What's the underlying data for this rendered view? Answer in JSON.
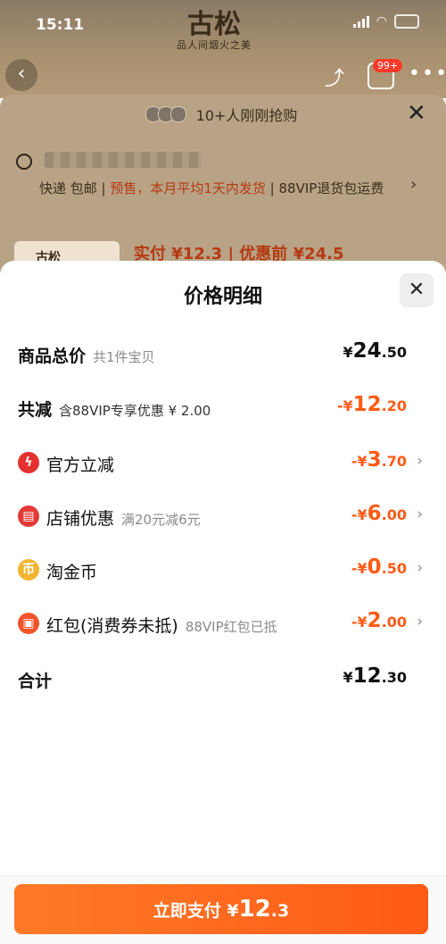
{
  "status_bar": {
    "time": "15:11"
  },
  "brand": {
    "logo_text": "古松",
    "tagline": "品人间烟火之美"
  },
  "header": {
    "cart_badge": "99+"
  },
  "background_sheet": {
    "social_proof": "10+人刚刚抢购",
    "shipping_prefix": "快递 包邮 | ",
    "shipping_warn": "预售，本月平均1天内发货",
    "shipping_suffix": " | 88VIP退货包运费",
    "product_brand": "古松",
    "price_preview": "实付 ¥12.3 | 优惠前 ¥24.5"
  },
  "modal": {
    "title": "价格明细",
    "rows": [
      {
        "label": "商品总价",
        "sub": "共1件宝贝",
        "amount_sym": "¥",
        "amount_int": "24",
        "amount_dec": ".50"
      },
      {
        "label": "共减",
        "sub": "含88VIP专享优惠 ¥ 2.00",
        "amount_sym": "-¥",
        "amount_int": "12",
        "amount_dec": ".20"
      },
      {
        "label": "官方立减",
        "sub": "",
        "amount_sym": "-¥",
        "amount_int": "3",
        "amount_dec": ".70"
      },
      {
        "label": "店铺优惠",
        "sub": "满20元减6元",
        "amount_sym": "-¥",
        "amount_int": "6",
        "amount_dec": ".00"
      },
      {
        "label": "淘金币",
        "sub": "",
        "amount_sym": "-¥",
        "amount_int": "0",
        "amount_dec": ".50"
      },
      {
        "label": "红包(消费券未抵)",
        "sub": "88VIP红包已抵",
        "amount_sym": "-¥",
        "amount_int": "2",
        "amount_dec": ".00"
      },
      {
        "label": "合计",
        "sub": "",
        "amount_sym": "¥",
        "amount_int": "12",
        "amount_dec": ".30"
      }
    ],
    "icons": [
      "lightning-icon",
      "shop-icon",
      "gold-coin-icon",
      "red-packet-icon"
    ]
  },
  "pay_button": {
    "prefix": "立即支付 ¥",
    "amount_int": "12",
    "amount_dec": ".3"
  },
  "colors": {
    "accent": "#ff5b16",
    "discount_icon_red": "#e5312f",
    "coin_gold": "#f2b531"
  }
}
